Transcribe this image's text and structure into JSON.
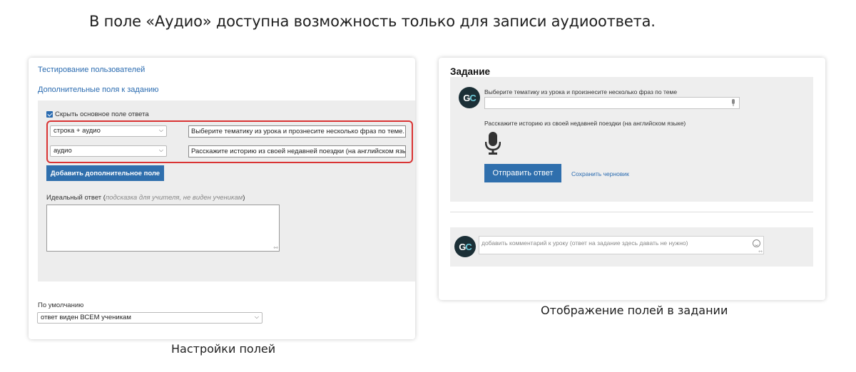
{
  "heading": "В поле «Аудио» доступна возможность только для записи аудиоответа.",
  "settings_panel": {
    "link_testing": "Тестирование пользователей",
    "link_extra_fields": "Дополнительные поля к заданию",
    "hide_main_field_label": "Скрыть основное поле ответа",
    "fields": [
      {
        "type": "строка + аудио",
        "text": "Выберите тематику из урока и прознесите несколько фраз по теме."
      },
      {
        "type": "аудио",
        "text": "Расскажите историю из своей недавней поездки (на английском языке)"
      }
    ],
    "add_field_button": "Добавить дополнительное поле",
    "ideal_answer_label": "Идеальный ответ (",
    "ideal_answer_hint": "подсказка для учителя, не виден ученикам",
    "ideal_answer_close": ")",
    "default_label": "По умолчанию",
    "default_value": "ответ виден ВСЕМ ученикам",
    "caption": "Настройки полей"
  },
  "task_panel": {
    "title": "Задание",
    "avatar_text": "GC",
    "question_1": "Выберите тематику из урока и произнесите несколько фраз по теме",
    "question_2": "Расскажите историю из своей недавней поездки (на английском языке)",
    "send_button": "Отправить ответ",
    "save_draft": "Сохранить черновик",
    "comment_placeholder": "добавить комментарий к уроку (ответ на задание здесь давать не нужно)",
    "caption": "Отображение полей в задании"
  },
  "colors": {
    "accent_blue": "#2f6fad",
    "link_blue": "#2a6bb0",
    "highlight_red": "#d93434",
    "avatar_dark": "#1b2f36"
  }
}
